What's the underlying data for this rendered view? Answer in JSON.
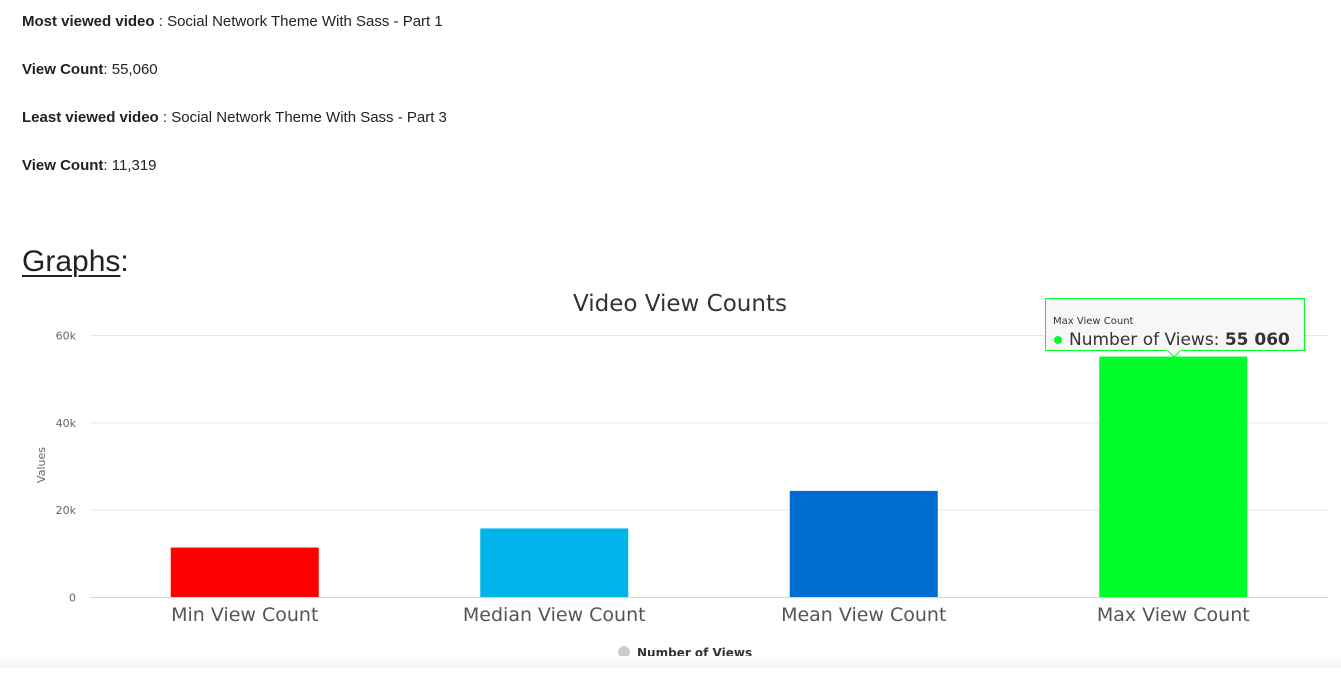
{
  "stats": {
    "most_viewed_label": "Most viewed video",
    "most_viewed_title": "Social Network Theme With Sass - Part 1",
    "most_count_label": "View Count",
    "most_count_value": "55,060",
    "least_viewed_label": "Least viewed video",
    "least_viewed_title": "Social Network Theme With Sass - Part 3",
    "least_count_label": "View Count",
    "least_count_value": "11,319"
  },
  "graphs_heading": "Graphs",
  "graphs_colon": ":",
  "tooltip": {
    "header": "Max View Count",
    "series_label": "Number of Views: ",
    "value": "55 060",
    "color": "#00ff2a"
  },
  "chart_data": {
    "type": "bar",
    "title": "Video View Counts",
    "xlabel": "",
    "ylabel": "Values",
    "categories": [
      "Min View Count",
      "Median View Count",
      "Mean View Count",
      "Max View Count"
    ],
    "series": [
      {
        "name": "Number of Views",
        "values": [
          11319,
          15700,
          24300,
          55060
        ],
        "colors": [
          "#ff0000",
          "#00b4ea",
          "#006bd1",
          "#00ff2a"
        ]
      }
    ],
    "ylim": [
      0,
      60000
    ],
    "yticks": [
      {
        "value": 0,
        "label": "0"
      },
      {
        "value": 20000,
        "label": "20k"
      },
      {
        "value": 40000,
        "label": "40k"
      },
      {
        "value": 60000,
        "label": "60k"
      }
    ],
    "grid": true,
    "legend": {
      "position": "bottom-center",
      "label": "Number of Views",
      "marker_color": "#cccccc"
    }
  }
}
